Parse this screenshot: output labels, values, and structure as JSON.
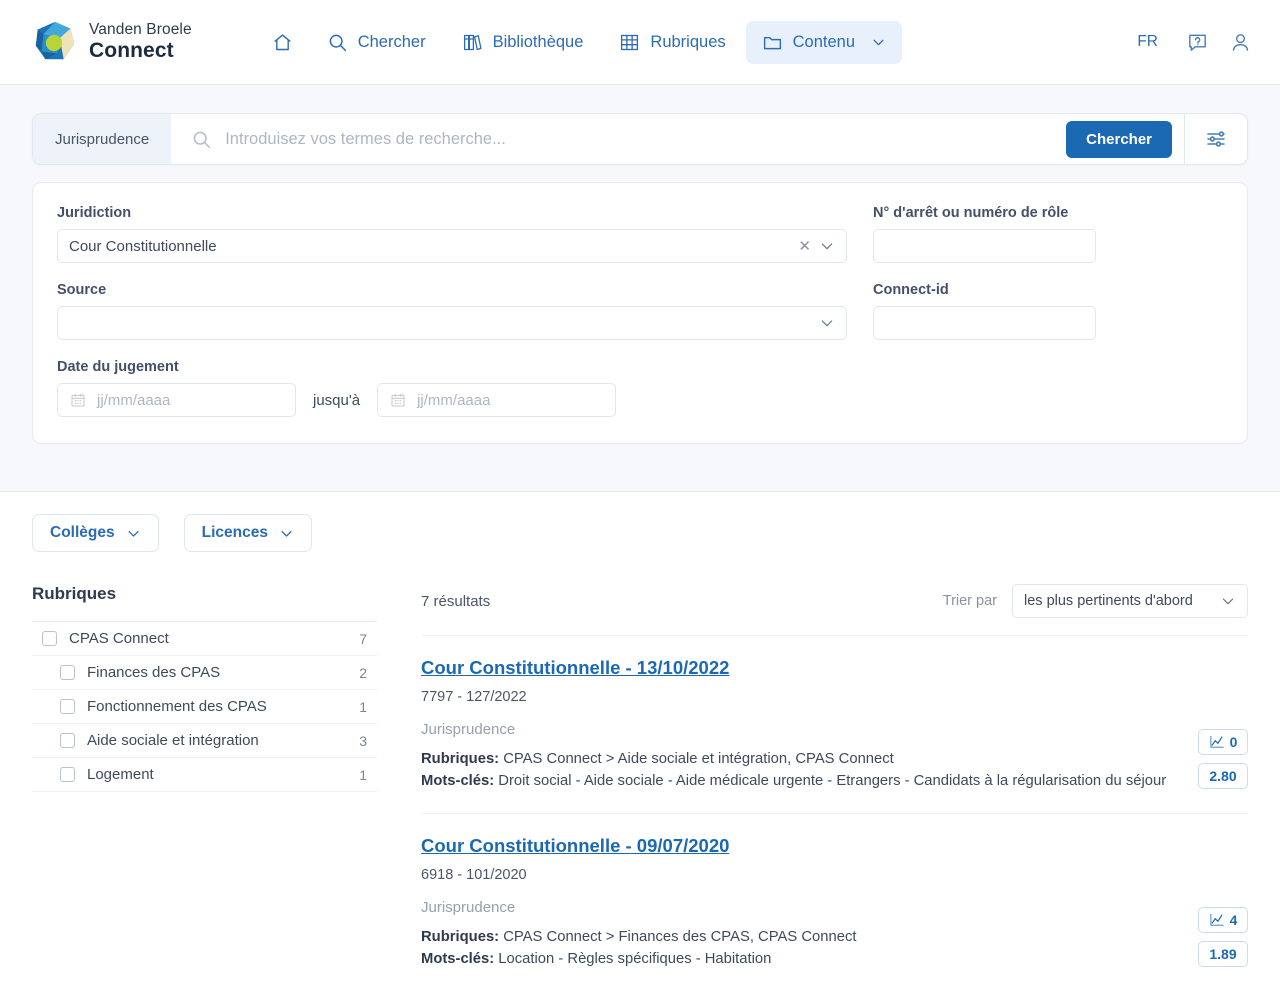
{
  "brand": {
    "top": "Vanden Broele",
    "bottom": "Connect",
    "logo_icon": "polygon-globe-logo"
  },
  "nav": {
    "items": [
      {
        "label": "",
        "icon": "home-icon",
        "active": false
      },
      {
        "label": "Chercher",
        "icon": "search-icon",
        "active": false
      },
      {
        "label": "Bibliothèque",
        "icon": "library-books-icon",
        "active": false
      },
      {
        "label": "Rubriques",
        "icon": "grid-table-icon",
        "active": false
      },
      {
        "label": "Contenu",
        "icon": "folder-icon",
        "active": true,
        "chevron": "chevron-down-icon"
      }
    ],
    "language": "FR",
    "help_icon": "help-chat-icon",
    "account_icon": "user-account-icon"
  },
  "search": {
    "scope": "Jurisprudence",
    "placeholder": "Introduisez vos termes de recherche...",
    "value": "",
    "submit_label": "Chercher",
    "magnifier_icon": "search-icon",
    "tune_icon": "sliders-settings-icon",
    "accent_color": "#1b68b3"
  },
  "advanced": {
    "juridiction": {
      "label": "Juridiction",
      "value": "Cour Constitutionnelle",
      "clear_icon": "close-x-icon",
      "chevron_icon": "chevron-down-icon"
    },
    "arret": {
      "label": "N° d'arrêt ou numéro de rôle",
      "value": "",
      "placeholder": ""
    },
    "source": {
      "label": "Source",
      "value": "",
      "chevron_icon": "chevron-down-icon"
    },
    "connect_id": {
      "label": "Connect-id",
      "value": "",
      "placeholder": ""
    },
    "date": {
      "label": "Date du jugement",
      "from_placeholder": "jj/mm/aaaa",
      "from_value": "",
      "to_placeholder": "jj/mm/aaaa",
      "to_value": "",
      "separator": "jusqu'à",
      "calendar_icon": "calendar-icon"
    }
  },
  "chips": [
    {
      "label": "Collèges",
      "icon": "chevron-down-icon"
    },
    {
      "label": "Licences",
      "icon": "chevron-down-icon"
    }
  ],
  "sidebar": {
    "title": "Rubriques",
    "facets": [
      {
        "label": "CPAS Connect",
        "count": "7",
        "level": 0
      },
      {
        "label": "Finances des CPAS",
        "count": "2",
        "level": 1
      },
      {
        "label": "Fonctionnement des CPAS",
        "count": "1",
        "level": 1
      },
      {
        "label": "Aide sociale et intégration",
        "count": "3",
        "level": 1
      },
      {
        "label": "Logement",
        "count": "1",
        "level": 1
      }
    ]
  },
  "results_header": {
    "count_text": "7 résultats",
    "sort_label": "Trier par",
    "sort_value": "les plus pertinents d'abord",
    "sort_chevron": "chevron-down-icon"
  },
  "results": [
    {
      "title": "Cour Constitutionnelle - 13/10/2022",
      "reference": "7797 - 127/2022",
      "type": "Jurisprudence",
      "rubriques_label": "Rubriques:",
      "rubriques_value": " CPAS Connect > Aide sociale et intégration, CPAS Connect",
      "motscles_label": "Mots-clés:",
      "motscles_value": " Droit social - Aide sociale - Aide médicale urgente - Etrangers - Candidats à la régularisation du séjour",
      "badge_chart": "0",
      "badge_chart_icon": "line-chart-icon",
      "badge_score": "2.80"
    },
    {
      "title": "Cour Constitutionnelle - 09/07/2020",
      "reference": "6918 - 101/2020",
      "type": "Jurisprudence",
      "rubriques_label": "Rubriques:",
      "rubriques_value": " CPAS Connect > Finances des CPAS, CPAS Connect",
      "motscles_label": "Mots-clés:",
      "motscles_value": " Location - Règles spécifiques - Habitation",
      "badge_chart": "4",
      "badge_chart_icon": "line-chart-icon",
      "badge_score": "1.89"
    }
  ]
}
